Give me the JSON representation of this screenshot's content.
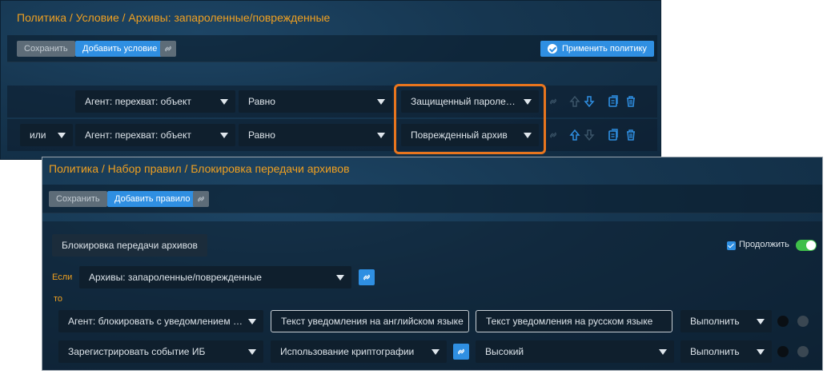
{
  "colors": {
    "accent": "#2f8fe2",
    "title": "#f0a020",
    "highlight": "#e8751e",
    "toggle_on": "#3fbf4a"
  },
  "condition_panel": {
    "breadcrumb": "Политика / Условие / Архивы: запароленные/поврежденные",
    "toolbar": {
      "save_label": "Сохранить",
      "add_condition_label": "Добавить условие",
      "apply_policy_label": "Применить политику"
    },
    "rows": [
      {
        "operator": "",
        "field": "Агент: перехват: объект",
        "comparison": "Равно",
        "value": "Защищенный паролем архив"
      },
      {
        "operator": "или",
        "field": "Агент: перехват: объект",
        "comparison": "Равно",
        "value": "Поврежденный архив"
      }
    ]
  },
  "rule_panel": {
    "breadcrumb": "Политика / Набор правил / Блокировка передачи архивов",
    "toolbar": {
      "save_label": "Сохранить",
      "add_rule_label": "Добавить правило"
    },
    "rule_name": "Блокировка передачи архивов",
    "continue_label": "Продолжить",
    "continue_checked": true,
    "toggle_on": true,
    "if_label": "Если",
    "if_condition": "Архивы: запароленные/поврежденные",
    "then_label": "то",
    "actions": [
      {
        "action": "Агент: блокировать с уведомлением пользователя",
        "text_en_placeholder": "Текст уведомления на английском языке",
        "text_ru_placeholder": "Текст уведомления на русском языке",
        "execute": "Выполнить"
      },
      {
        "action": "Зарегистрировать событие ИБ",
        "detail": "Использование криптографии",
        "severity": "Высокий",
        "execute": "Выполнить"
      }
    ]
  }
}
